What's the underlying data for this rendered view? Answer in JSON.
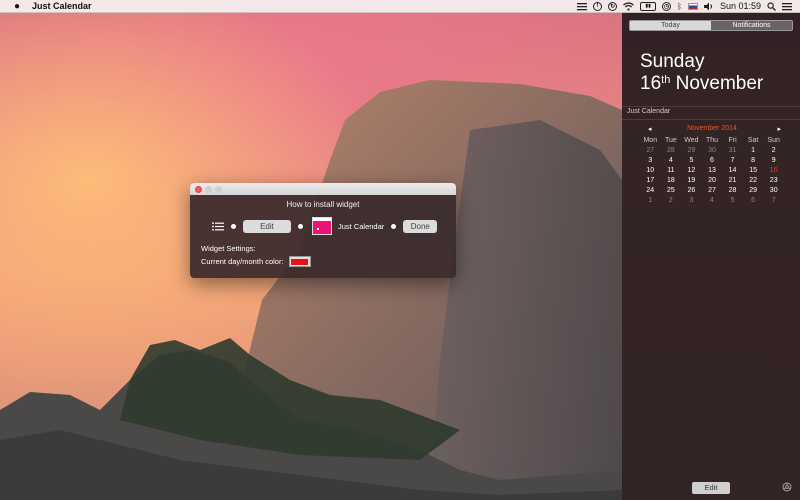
{
  "menubar": {
    "app_name": "Just Calendar",
    "clock": "Sun 01:59",
    "status_icons": [
      "list-icon",
      "info-icon",
      "sync-icon",
      "wifi-icon",
      "battery-icon",
      "time-machine-icon",
      "bluetooth-icon",
      "flag-icon",
      "volume-icon"
    ]
  },
  "dialog": {
    "title": "How to install widget",
    "edit_label": "Edit",
    "widget_name": "Just Calendar",
    "done_label": "Done",
    "settings_label": "Widget Settings:",
    "color_label": "Current day/month color:",
    "current_color": "#ee1111"
  },
  "notification_center": {
    "tab_today": "Today",
    "tab_notifications": "Notifications",
    "day_name": "Sunday",
    "date_num": "16",
    "date_suffix": "th",
    "date_month": "November",
    "widget_title": "Just Calendar",
    "edit_label": "Edit",
    "calendar": {
      "month_label": "November 2014",
      "prev": "◂",
      "next": "▸",
      "weekdays": [
        "Mon",
        "Tue",
        "Wed",
        "Thu",
        "Fri",
        "Sat",
        "Sun"
      ],
      "weeks": [
        [
          {
            "d": "27",
            "c": "oth"
          },
          {
            "d": "28",
            "c": "oth"
          },
          {
            "d": "29",
            "c": "oth"
          },
          {
            "d": "30",
            "c": "oth"
          },
          {
            "d": "31",
            "c": "oth"
          },
          {
            "d": "1",
            "c": "cur"
          },
          {
            "d": "2",
            "c": "cur"
          }
        ],
        [
          {
            "d": "3",
            "c": "cur"
          },
          {
            "d": "4",
            "c": "cur"
          },
          {
            "d": "5",
            "c": "cur"
          },
          {
            "d": "6",
            "c": "cur"
          },
          {
            "d": "7",
            "c": "cur"
          },
          {
            "d": "8",
            "c": "cur"
          },
          {
            "d": "9",
            "c": "cur"
          }
        ],
        [
          {
            "d": "10",
            "c": "cur"
          },
          {
            "d": "11",
            "c": "cur"
          },
          {
            "d": "12",
            "c": "cur"
          },
          {
            "d": "13",
            "c": "cur"
          },
          {
            "d": "14",
            "c": "cur"
          },
          {
            "d": "15",
            "c": "cur"
          },
          {
            "d": "16",
            "c": "today"
          }
        ],
        [
          {
            "d": "17",
            "c": "cur"
          },
          {
            "d": "18",
            "c": "cur"
          },
          {
            "d": "19",
            "c": "cur"
          },
          {
            "d": "20",
            "c": "cur"
          },
          {
            "d": "21",
            "c": "cur"
          },
          {
            "d": "22",
            "c": "cur"
          },
          {
            "d": "23",
            "c": "cur"
          }
        ],
        [
          {
            "d": "24",
            "c": "cur"
          },
          {
            "d": "25",
            "c": "cur"
          },
          {
            "d": "26",
            "c": "cur"
          },
          {
            "d": "27",
            "c": "cur"
          },
          {
            "d": "28",
            "c": "cur"
          },
          {
            "d": "29",
            "c": "cur"
          },
          {
            "d": "30",
            "c": "cur"
          }
        ],
        [
          {
            "d": "1",
            "c": "oth"
          },
          {
            "d": "2",
            "c": "oth"
          },
          {
            "d": "3",
            "c": "oth"
          },
          {
            "d": "4",
            "c": "oth"
          },
          {
            "d": "5",
            "c": "oth"
          },
          {
            "d": "6",
            "c": "oth"
          },
          {
            "d": "7",
            "c": "oth"
          }
        ]
      ]
    }
  },
  "colors": {
    "accent_month": "#ee5522",
    "today_highlight": "#ff3322",
    "close_button": "#f25b52"
  }
}
